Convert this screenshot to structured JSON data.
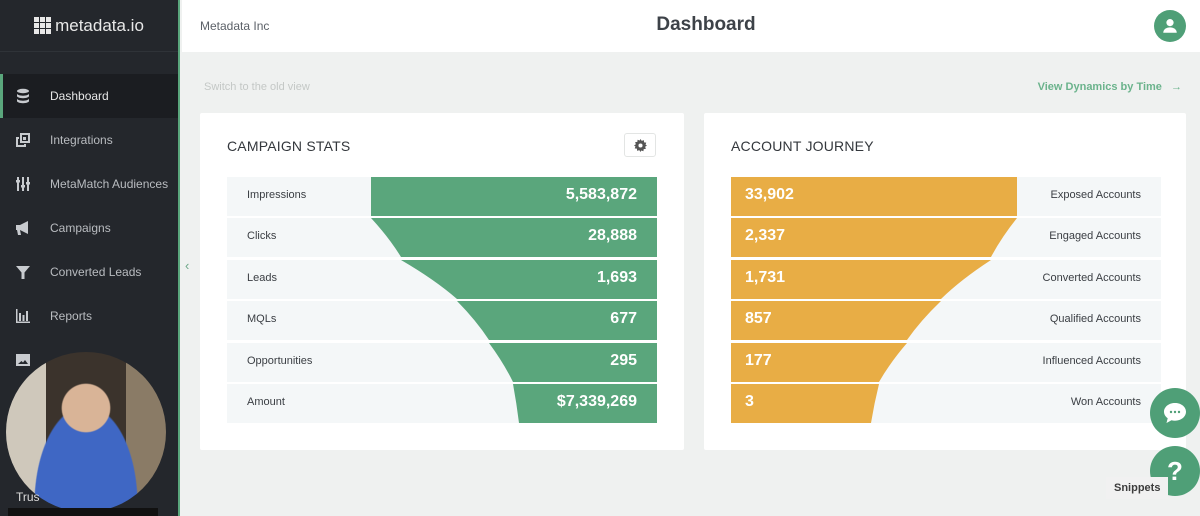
{
  "brand": {
    "name": "metadata.io",
    "accent": "#5aa67c"
  },
  "sidebar": {
    "items": [
      {
        "label": "Dashboard",
        "icon": "database-icon",
        "active": true
      },
      {
        "label": "Integrations",
        "icon": "integrations-icon",
        "active": false
      },
      {
        "label": "MetaMatch Audiences",
        "icon": "sliders-icon",
        "active": false
      },
      {
        "label": "Campaigns",
        "icon": "megaphone-icon",
        "active": false
      },
      {
        "label": "Converted Leads",
        "icon": "funnel-icon",
        "active": false
      },
      {
        "label": "Reports",
        "icon": "bar-chart-icon",
        "active": false
      },
      {
        "label": "",
        "icon": "image-icon",
        "active": false
      }
    ],
    "webcam_caption": "Trus"
  },
  "header": {
    "company": "Metadata Inc",
    "title": "Dashboard"
  },
  "links": {
    "switch_view": "Switch to the old view",
    "dynamics": "View Dynamics by Time",
    "dynamics_arrow": "→"
  },
  "campaign_stats": {
    "title": "CAMPAIGN STATS",
    "color": "#5aa67c",
    "rows": [
      {
        "label": "Impressions",
        "value": "5,583,872"
      },
      {
        "label": "Clicks",
        "value": "28,888"
      },
      {
        "label": "Leads",
        "value": "1,693"
      },
      {
        "label": "MQLs",
        "value": "677"
      },
      {
        "label": "Opportunities",
        "value": "295"
      },
      {
        "label": "Amount",
        "value": "$7,339,269"
      }
    ]
  },
  "account_journey": {
    "title": "ACCOUNT JOURNEY",
    "color": "#e8ad45",
    "rows": [
      {
        "label": "Exposed Accounts",
        "value": "33,902"
      },
      {
        "label": "Engaged Accounts",
        "value": "2,337"
      },
      {
        "label": "Converted Accounts",
        "value": "1,731"
      },
      {
        "label": "Qualified Accounts",
        "value": "857"
      },
      {
        "label": "Influenced Accounts",
        "value": "177"
      },
      {
        "label": "Won Accounts",
        "value": "3"
      }
    ]
  },
  "floating": {
    "help_label": "?",
    "snippets_label": "Snippets"
  }
}
